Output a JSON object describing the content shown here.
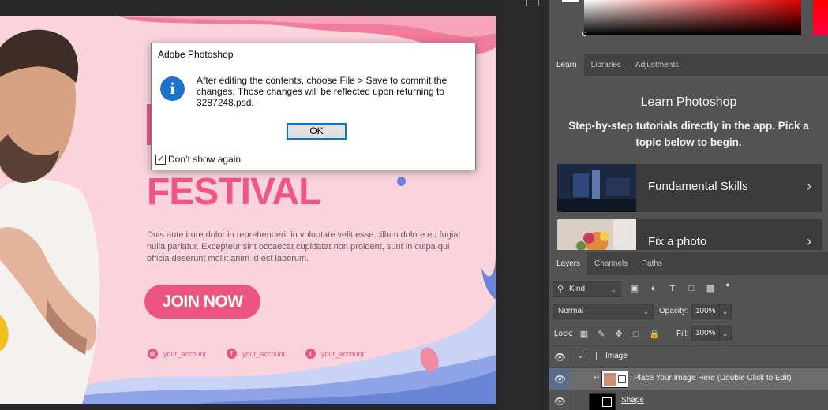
{
  "dialog": {
    "title": "Adobe Photoshop",
    "message": "After editing the contents, choose File > Save to commit the changes.  Those changes will be reflected upon returning to 3287248.psd.",
    "ok_label": "OK",
    "checkbox_label": "Don’t show again",
    "checkbox_checked": true
  },
  "canvas": {
    "headline": "FESTIVAL",
    "body": "Duis aute irure dolor in reprehenderit in voluptate velit esse cillum dolore eu fugiat nulla pariatur. Excepteur sint occaecat cupidatat non proident, sunt in culpa qui officia deserunt mollit anim id est laborum.",
    "cta": "JOIN NOW",
    "socials": [
      {
        "icon": "instagram-icon",
        "glyph": "◎",
        "handle": "your_account"
      },
      {
        "icon": "facebook-icon",
        "glyph": "f",
        "handle": "your_account"
      },
      {
        "icon": "twitter-icon",
        "glyph": "t",
        "handle": "your_account"
      }
    ],
    "colors": {
      "accent": "#ec5580",
      "background": "#fbd3dc",
      "wave": "#6b85d6"
    }
  },
  "learn_tabs": [
    "Learn",
    "Libraries",
    "Adjustments"
  ],
  "learn": {
    "title": "Learn Photoshop",
    "subtitle": "Step-by-step tutorials directly in the app. Pick a topic below to begin.",
    "cards": [
      {
        "label": "Fundamental Skills",
        "chevron": "›"
      },
      {
        "label": "Fix a photo",
        "chevron": "›"
      }
    ]
  },
  "layers_tabs": [
    "Layers",
    "Channels",
    "Paths"
  ],
  "layers": {
    "filter_kind": "Kind",
    "blend_mode": "Normal",
    "opacity_label": "Opacity:",
    "opacity": "100%",
    "lock_label": "Lock:",
    "fill_label": "Fill:",
    "fill": "100%",
    "items": [
      {
        "name": "Image",
        "type": "group"
      },
      {
        "name": "Place Your Image Here (Double Click to Edit)",
        "type": "smart-object"
      },
      {
        "name": "Shape",
        "type": "shape"
      }
    ]
  }
}
